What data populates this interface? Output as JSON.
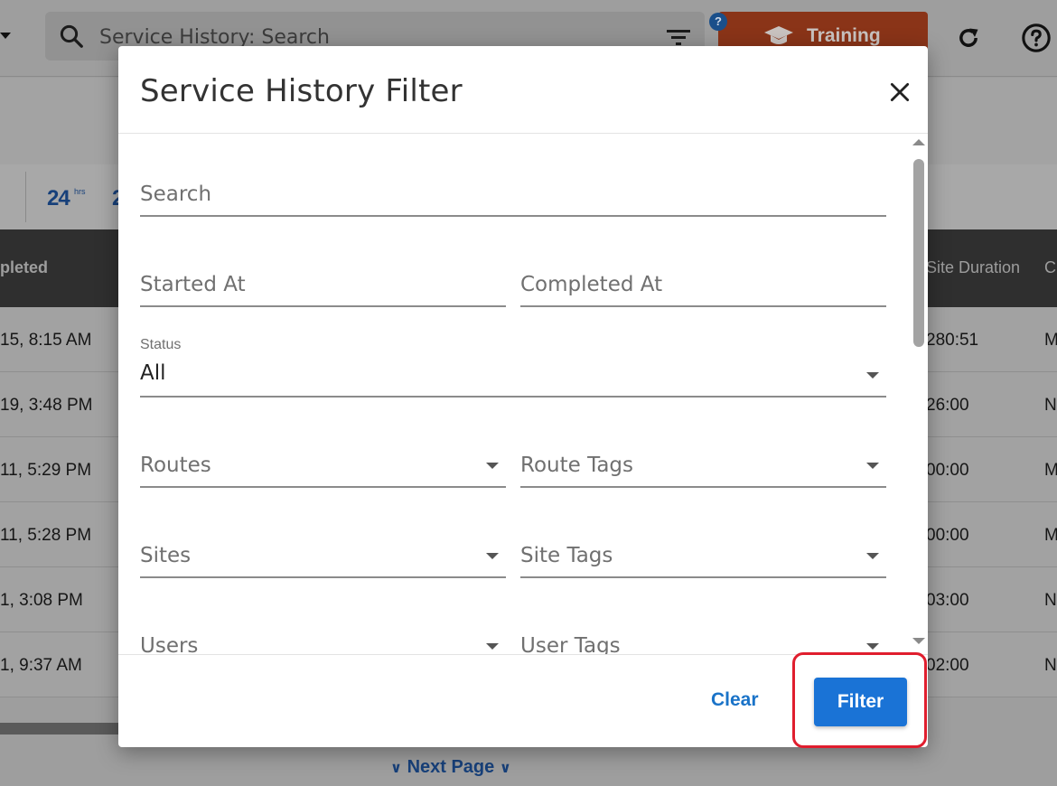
{
  "app": {
    "search_placeholder": "Service History: Search",
    "help_bubble": "?",
    "training_label": "Training"
  },
  "toolbar": {
    "hours_24_number": "24",
    "hours_24_sup": "hrs",
    "partial_digit": "2"
  },
  "table": {
    "headers": {
      "completed": "pleted",
      "site_duration": "Site Duration",
      "next_col": "C"
    },
    "rows": [
      {
        "completed": "15, 8:15 AM",
        "duration": "280:51",
        "next": "M"
      },
      {
        "completed": "19, 3:48 PM",
        "duration": "26:00",
        "next": "N"
      },
      {
        "completed": "11, 5:29 PM",
        "duration": "00:00",
        "next": "M"
      },
      {
        "completed": "11, 5:28 PM",
        "duration": "00:00",
        "next": "M"
      },
      {
        "completed": "1, 3:08 PM",
        "duration": "03:00",
        "next": "N"
      },
      {
        "completed": "1, 9:37 AM",
        "duration": "02:00",
        "next": "N"
      }
    ],
    "next_page_label": "Next Page"
  },
  "modal": {
    "title": "Service History Filter",
    "fields": {
      "search_placeholder": "Search",
      "started_at_placeholder": "Started At",
      "completed_at_placeholder": "Completed At",
      "status_label": "Status",
      "status_value": "All",
      "routes_placeholder": "Routes",
      "route_tags_placeholder": "Route Tags",
      "sites_placeholder": "Sites",
      "site_tags_placeholder": "Site Tags",
      "users_placeholder": "Users",
      "user_tags_placeholder": "User Tags"
    },
    "buttons": {
      "clear": "Clear",
      "filter": "Filter"
    }
  },
  "colors": {
    "primary": "#1a73d6",
    "highlight": "#e01e2e",
    "training": "#e05a2a"
  }
}
